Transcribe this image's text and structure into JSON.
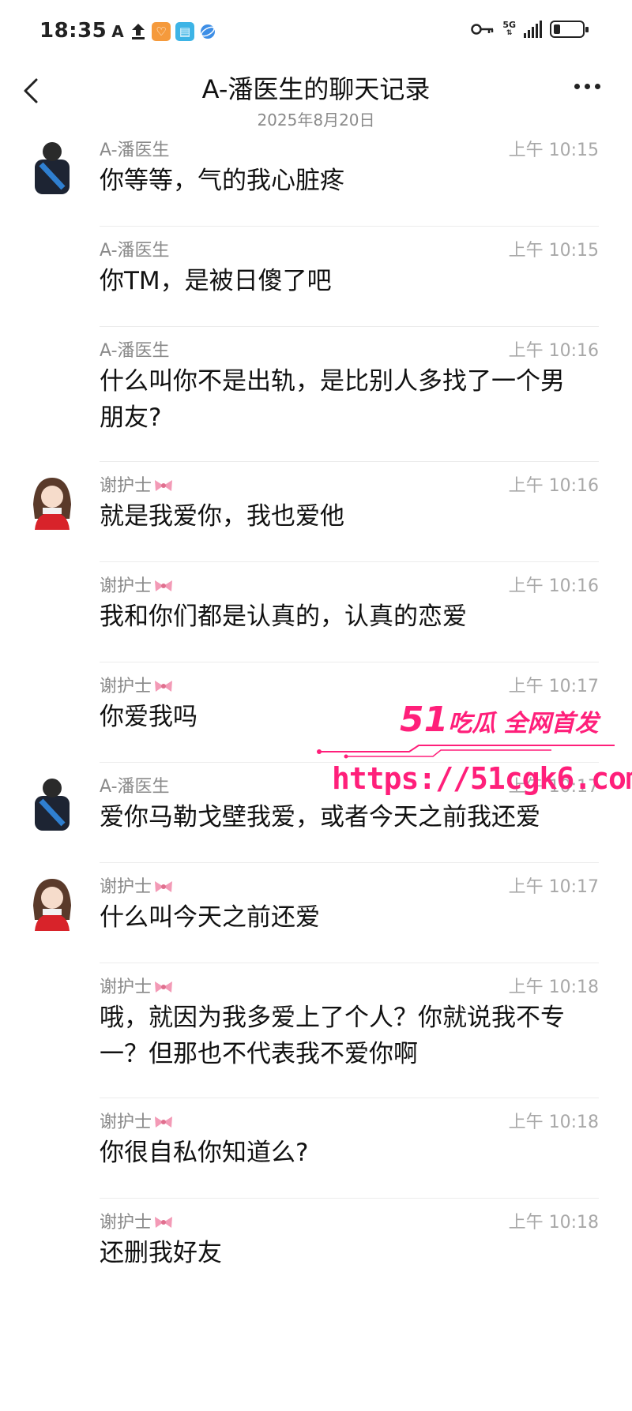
{
  "status_bar": {
    "time": "18:35",
    "network_label": "5G",
    "left_icons": [
      "font-icon",
      "upload-icon",
      "heart-app-icon",
      "book-app-icon",
      "globe-app-icon"
    ],
    "right_icons": [
      "key-icon",
      "signal-icon",
      "battery-icon"
    ]
  },
  "header": {
    "title": "A-潘医生的聊天记录",
    "subtitle": "2025年8月20日"
  },
  "messages": [
    {
      "sender": "A-潘医生",
      "time": "上午 10:15",
      "text": "你等等，气的我心脏疼",
      "avatar": "male"
    },
    {
      "sender": "A-潘医生",
      "time": "上午 10:15",
      "text": "你TM，是被日傻了吧",
      "avatar": ""
    },
    {
      "sender": "A-潘医生",
      "time": "上午 10:16",
      "text": "什么叫你不是出轨，是比别人多找了一个男朋友?",
      "avatar": ""
    },
    {
      "sender": "谢护士",
      "time": "上午 10:16",
      "text": "就是我爱你，我也爱他",
      "avatar": "female"
    },
    {
      "sender": "谢护士",
      "time": "上午 10:16",
      "text": "我和你们都是认真的，认真的恋爱",
      "avatar": ""
    },
    {
      "sender": "谢护士",
      "time": "上午 10:17",
      "text": "你爱我吗",
      "avatar": ""
    },
    {
      "sender": "A-潘医生",
      "time": "上午 10:17",
      "text": "爱你马勒戈壁我爱，或者今天之前我还爱",
      "avatar": "male"
    },
    {
      "sender": "谢护士",
      "time": "上午 10:17",
      "text": "什么叫今天之前还爱",
      "avatar": "female"
    },
    {
      "sender": "谢护士",
      "time": "上午 10:18",
      "text": "哦，就因为我多爱上了个人？你就说我不专一？但那也不代表我不爱你啊",
      "avatar": ""
    },
    {
      "sender": "谢护士",
      "time": "上午 10:18",
      "text": "你很自私你知道么?",
      "avatar": ""
    },
    {
      "sender": "谢护士",
      "time": "上午 10:18",
      "text": "还删我好友",
      "avatar": ""
    }
  ],
  "watermark": {
    "brand_number": "51",
    "brand_text": "吃瓜 全网首发",
    "url": "https://51cgk6.com"
  },
  "colors": {
    "watermark": "#ff1f7a",
    "meta_text": "#8a8a8a",
    "divider": "#ececec"
  }
}
